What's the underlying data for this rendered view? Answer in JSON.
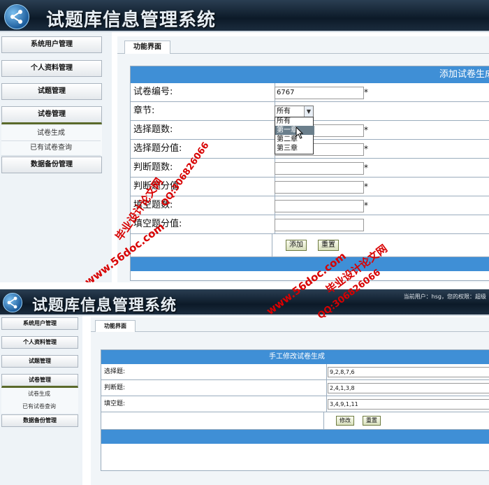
{
  "app_title": "试题库信息管理系统",
  "user_info": "当前用户：hsg，您的权限：超级",
  "sidebar": {
    "items": [
      "系统用户管理",
      "个人资料管理",
      "试题管理",
      "试卷管理",
      "数据备份管理"
    ],
    "subitems": [
      "试卷生成",
      "已有试卷查询"
    ]
  },
  "tab_label": "功能界面",
  "form1": {
    "header": "添加试卷生成",
    "fields": [
      {
        "label": "试卷编号:",
        "value": "6767"
      },
      {
        "label": "章节:",
        "value": "所有"
      },
      {
        "label": "选择题数:",
        "value": ""
      },
      {
        "label": "选择题分值:",
        "value": ""
      },
      {
        "label": "判断题数:",
        "value": ""
      },
      {
        "label": "判断题分值",
        "value": ""
      },
      {
        "label": "填空题数:",
        "value": ""
      },
      {
        "label": "填空题分值:",
        "value": ""
      }
    ],
    "required_mark": "*",
    "dropdown_options": [
      "所有",
      "第一章",
      "第二章",
      "第三章"
    ],
    "add_button": "添加",
    "reset_button": "重置"
  },
  "form2": {
    "header": "手工修改试卷生成",
    "fields": [
      {
        "label": "选择题:",
        "value": "9,2,8,7,6"
      },
      {
        "label": "判断题:",
        "value": "2,4,1,3,8"
      },
      {
        "label": "填空题:",
        "value": "3,4,9,1,11"
      }
    ],
    "modify_button": "修改",
    "reset_button": "重置"
  },
  "watermarks": {
    "name": "毕业设计论文网",
    "qq": "QQ:306826066",
    "site": "www.56doc.com"
  }
}
